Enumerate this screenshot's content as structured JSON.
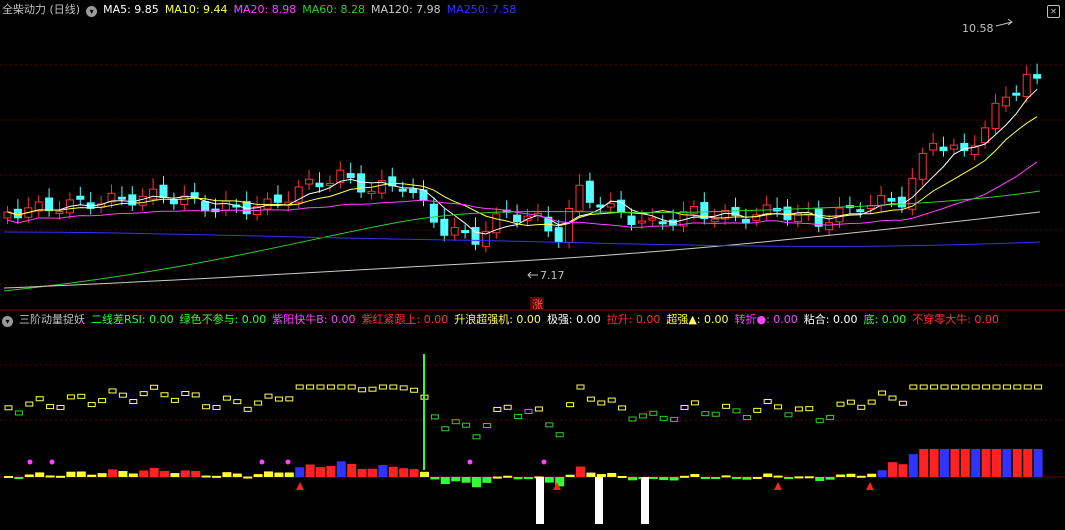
{
  "header": {
    "stock_title": "全柴动力 (日线)",
    "ma": [
      {
        "label": "MA5: 9.85",
        "color": "#ffffff"
      },
      {
        "label": "MA10: 9.44",
        "color": "#ffff55"
      },
      {
        "label": "MA20: 8.98",
        "color": "#ff44ff"
      },
      {
        "label": "MA60: 8.28",
        "color": "#33cc33"
      },
      {
        "label": "MA120: 7.98",
        "color": "#cccccc"
      },
      {
        "label": "MA250: 7.58",
        "color": "#3333ff"
      }
    ]
  },
  "price_chart": {
    "high_label": "10.58",
    "low_label": "7.17",
    "rise_marker": "涨",
    "up_color": "#ff3333",
    "down_color": "#54ffff"
  },
  "indicator": {
    "title": "三阶动量捉妖",
    "items": [
      {
        "label": "二线差RSI: 0.00",
        "color": "#33ff33"
      },
      {
        "label": "绿色不参与: 0.00",
        "color": "#33ff33"
      },
      {
        "label": "紫阳快牛B: 0.00",
        "color": "#ff44ff"
      },
      {
        "label": "紫红紧跟上: 0.00",
        "color": "#ff3333"
      },
      {
        "label": "升浪超强机: 0.00",
        "color": "#ffff55"
      },
      {
        "label": "极强: 0.00",
        "color": "#ffffff"
      },
      {
        "label": "拉升: 0.00",
        "color": "#ff3333"
      },
      {
        "label": "超强▲: 0.00",
        "color": "#ffff55"
      },
      {
        "label": "转折●: 0.00",
        "color": "#ff44ff"
      },
      {
        "label": "粘合: 0.00",
        "color": "#ffffff"
      },
      {
        "label": "底: 0.00",
        "color": "#33ff33"
      },
      {
        "label": "不穿零大牛: 0.00",
        "color": "#ff3333"
      }
    ]
  }
}
